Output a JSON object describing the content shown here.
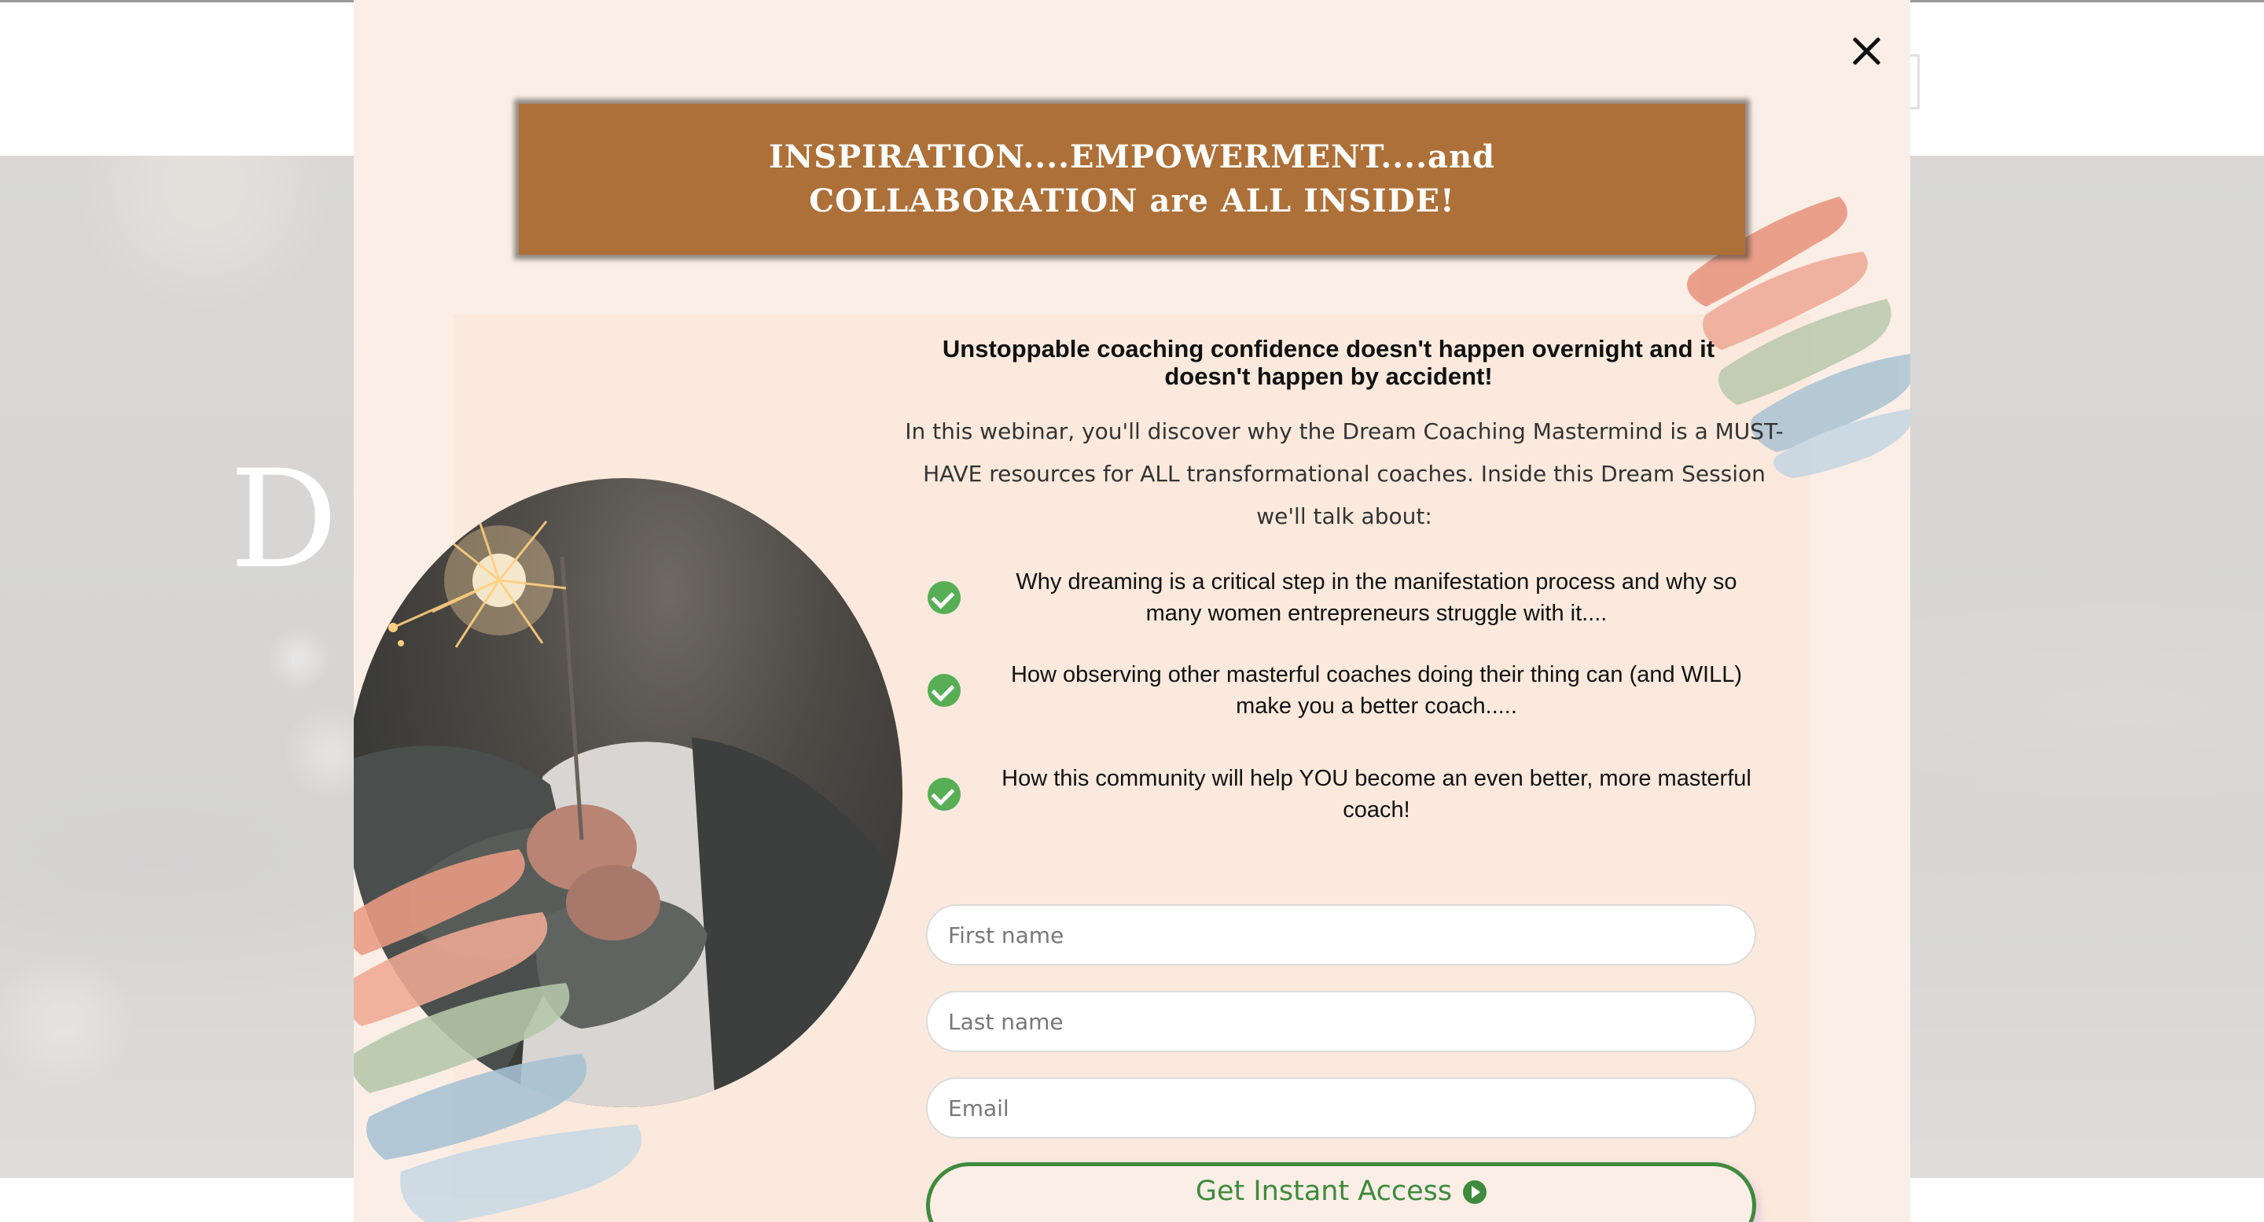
{
  "background_page": {
    "hero_title": "D"
  },
  "popup": {
    "banner_text": "INSPIRATION....EMPOWERMENT....and COLLABORATION are ALL INSIDE!",
    "headline": "Unstoppable coaching confidence doesn't happen overnight and it doesn't happen by accident!",
    "intro": "In this webinar, you'll discover why the Dream Coaching Mastermind is a MUST-HAVE resources for ALL transformational coaches. Inside this Dream Session we'll talk about:",
    "bullets": [
      "Why dreaming is a critical step in the manifestation process and why so many women entrepreneurs struggle with it....",
      "How observing other masterful coaches doing their thing can (and WILL) make you a better coach.....",
      "How this community will help YOU become an even better, more masterful coach!"
    ],
    "form": {
      "first_name_placeholder": "First name",
      "last_name_placeholder": "Last name",
      "email_placeholder": "Email",
      "submit_label": "Get Instant Access"
    }
  },
  "icons": {
    "close": "close-icon",
    "bullet": "check-circle-icon",
    "submit": "play-circle-icon"
  },
  "colors": {
    "banner": "#ad7038",
    "popup_background": "#faeee6",
    "check": "#57ae55",
    "cta": "#3f8a3c"
  }
}
